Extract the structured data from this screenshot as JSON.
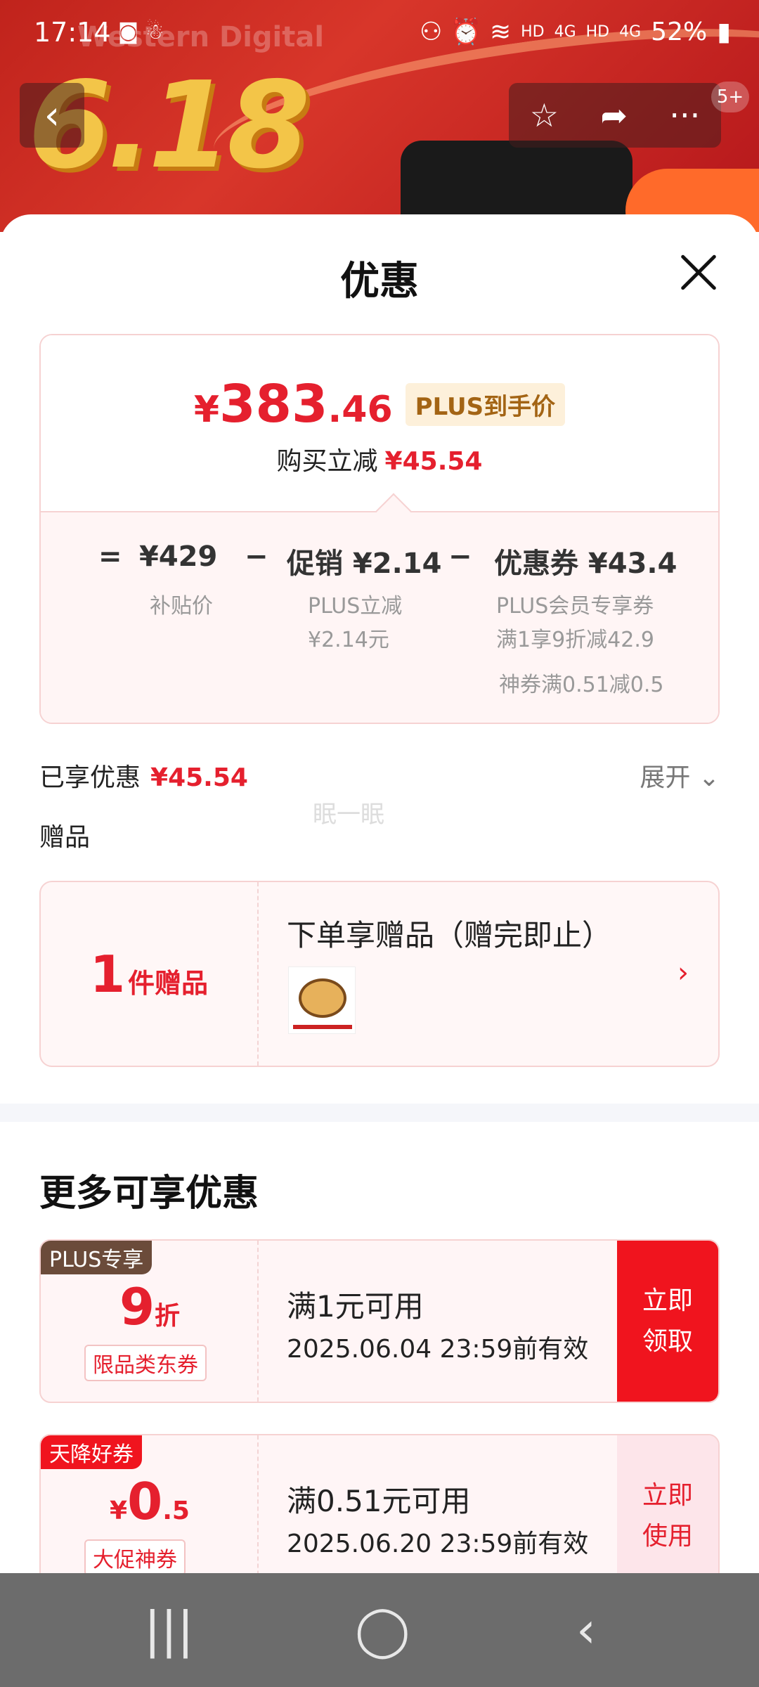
{
  "status_bar": {
    "time": "17:14",
    "battery": "52%",
    "left_icons": "◙ ☃",
    "right_icons": "⚇ ⏰ ≋",
    "hd1": "HD",
    "net1": "4G",
    "hd2": "HD",
    "net2": "4G"
  },
  "background": {
    "brand": "Western Digital",
    "promo": "6.18",
    "badge": "5+"
  },
  "sheet": {
    "title": "优惠"
  },
  "price_card": {
    "currency": "¥",
    "price_int": "383",
    "price_dec": ".46",
    "tag": "PLUS到手价",
    "sub_label": "购买立减",
    "sub_value": "¥45.54",
    "eq": "=",
    "base_price": "¥429",
    "base_label": "补贴价",
    "minus1": "−",
    "promo": "促销 ¥2.14",
    "promo_label1": "PLUS立减",
    "promo_label2": "¥2.14元",
    "minus2": "−",
    "coupon": "优惠券 ¥43.4",
    "coupon_label1": "PLUS会员专享券",
    "coupon_label2": "满1享9折减42.9",
    "coupon_label3": "神券满0.51减0.5"
  },
  "enjoyed": {
    "label": "已享优惠",
    "value": "¥45.54",
    "expand": "展开 ⌄"
  },
  "watermark": "眠一眠",
  "gift": {
    "section_title": "赠品",
    "count": "1",
    "count_label": "件赠品",
    "title": "下单享赠品（赠完即止）",
    "arrow": "›"
  },
  "more": {
    "title": "更多可享优惠",
    "coupons": [
      {
        "tag": "PLUS专享",
        "tag_color": "#6b4b3a",
        "value_big": "9",
        "value_small": "折",
        "sub": "限品类东券",
        "cond": "满1元可用",
        "expire": "2025.06.04 23:59前有效",
        "btn_line1": "立即",
        "btn_line2": "领取"
      },
      {
        "tag": "天降好券",
        "tag_color": "#f0141e",
        "value_prefix": "¥",
        "value_big": "0",
        "value_small": ".5",
        "sub": "大促神券",
        "cond": "满0.51元可用",
        "expire": "2025.06.20 23:59前有效",
        "btn_line1": "立即",
        "btn_line2": "使用"
      }
    ]
  },
  "navbar": {
    "recents": "|||",
    "home": "◯",
    "back": "‹"
  }
}
